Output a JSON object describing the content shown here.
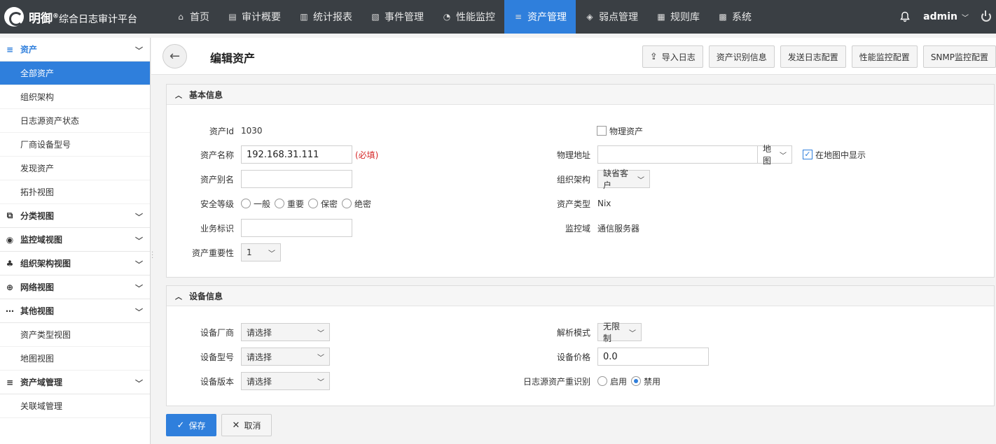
{
  "brand": {
    "name": "明御",
    "reg": "®",
    "sub": "综合日志审计平台"
  },
  "nav": [
    {
      "label": "首页",
      "icon": "home-icon",
      "glyph": "⌂"
    },
    {
      "label": "审计概要",
      "icon": "report-icon",
      "glyph": "▤"
    },
    {
      "label": "统计报表",
      "icon": "bar-chart-icon",
      "glyph": "▥"
    },
    {
      "label": "事件管理",
      "icon": "event-icon",
      "glyph": "▧"
    },
    {
      "label": "性能监控",
      "icon": "gauge-icon",
      "glyph": "◔"
    },
    {
      "label": "资产管理",
      "icon": "database-icon",
      "glyph": "≡"
    },
    {
      "label": "弱点管理",
      "icon": "target-icon",
      "glyph": "◈"
    },
    {
      "label": "规则库",
      "icon": "rules-icon",
      "glyph": "▦"
    },
    {
      "label": "系统",
      "icon": "grid-icon",
      "glyph": "▩"
    }
  ],
  "user": {
    "name": "admin"
  },
  "sidebar": {
    "groups": [
      {
        "label": "资产",
        "icon": "database-icon",
        "glyph": "≡",
        "items": [
          "全部资产",
          "组织架构",
          "日志源资产状态",
          "厂商设备型号",
          "发现资产",
          "拓扑视图"
        ]
      },
      {
        "label": "分类视图",
        "icon": "copy-icon",
        "glyph": "⧉",
        "items": []
      },
      {
        "label": "监控域视图",
        "icon": "webcam-icon",
        "glyph": "◉",
        "items": []
      },
      {
        "label": "组织架构视图",
        "icon": "org-chart-icon",
        "glyph": "♣",
        "items": []
      },
      {
        "label": "网络视图",
        "icon": "globe-icon",
        "glyph": "⊕",
        "items": []
      },
      {
        "label": "其他视图",
        "icon": "more-icon",
        "glyph": "⋯",
        "items": [
          "资产类型视图",
          "地图视图"
        ]
      },
      {
        "label": "资产域管理",
        "icon": "database-icon",
        "glyph": "≡",
        "items": [
          "关联域管理"
        ]
      }
    ],
    "active_item": "全部资产"
  },
  "page": {
    "title": "编辑资产",
    "actions": [
      "导入日志",
      "资产识别信息",
      "发送日志配置",
      "性能监控配置",
      "SNMP监控配置"
    ]
  },
  "basic": {
    "title": "基本信息",
    "asset_id_label": "资产Id",
    "asset_id": "1030",
    "name_label": "资产名称",
    "name_value": "192.168.31.111",
    "required": "(必填)",
    "alias_label": "资产别名",
    "alias_value": "",
    "security_label": "安全等级",
    "security_options": [
      "一般",
      "重要",
      "保密",
      "绝密"
    ],
    "business_label": "业务标识",
    "business_value": "",
    "importance_label": "资产重要性",
    "importance_value": "1",
    "physical_label": "物理资产",
    "physical_checked": false,
    "addr_label": "物理地址",
    "addr_value": "",
    "map_select": "地图",
    "show_on_map": "在地图中显示",
    "show_on_map_checked": true,
    "org_label": "组织架构",
    "org_value": "缺省客户",
    "type_label": "资产类型",
    "type_value": "Nix",
    "monitor_label": "监控域",
    "monitor_value": "通信服务器"
  },
  "device": {
    "title": "设备信息",
    "vendor_label": "设备厂商",
    "vendor_value": "请选择",
    "model_label": "设备型号",
    "model_value": "请选择",
    "version_label": "设备版本",
    "version_value": "请选择",
    "parse_label": "解析模式",
    "parse_value": "无限制",
    "price_label": "设备价格",
    "price_value": "0.0",
    "reident_label": "日志源资产重识别",
    "reident_options": [
      "启用",
      "禁用"
    ],
    "reident_selected": "禁用"
  },
  "footer": {
    "save": "保存",
    "cancel": "取消"
  }
}
